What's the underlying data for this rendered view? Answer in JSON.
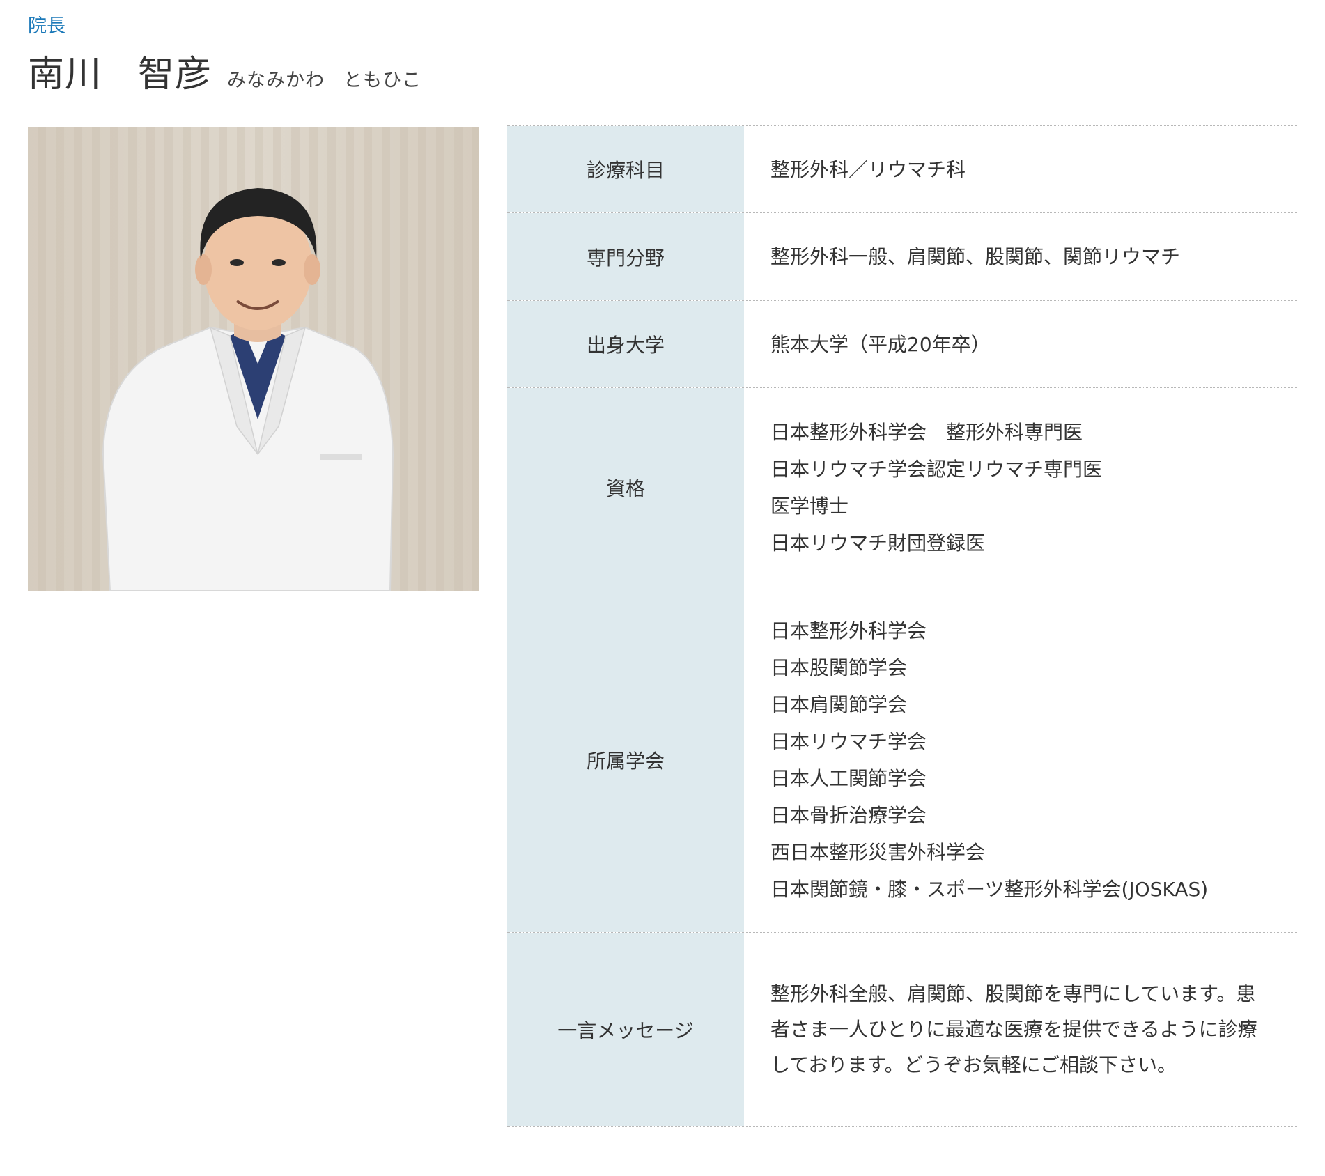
{
  "header": {
    "role": "院長",
    "name_family": "南川",
    "name_given": "智彦",
    "reading_family": "みなみかわ",
    "reading_given": "ともひこ"
  },
  "photo": {
    "alt": "院長 南川智彦の写真"
  },
  "profile": {
    "department": {
      "label": "診療科目",
      "value": "整形外科／リウマチ科"
    },
    "specialty": {
      "label": "専門分野",
      "value": "整形外科一般、肩関節、股関節、関節リウマチ"
    },
    "university": {
      "label": "出身大学",
      "value": "熊本大学（平成20年卒）"
    },
    "qualifications": {
      "label": "資格",
      "items": [
        "日本整形外科学会　整形外科専門医",
        "日本リウマチ学会認定リウマチ専門医",
        "医学博士",
        "日本リウマチ財団登録医"
      ]
    },
    "societies": {
      "label": "所属学会",
      "items": [
        "日本整形外科学会",
        "日本股関節学会",
        "日本肩関節学会",
        "日本リウマチ学会",
        "日本人工関節学会",
        "日本骨折治療学会",
        "西日本整形災害外科学会",
        "日本関節鏡・膝・スポーツ整形外科学会(JOSKAS)"
      ]
    },
    "message": {
      "label": "一言メッセージ",
      "value": "整形外科全般、肩関節、股関節を専門にしています。患者さま一人ひとりに最適な医療を提供できるように診療しております。どうぞお気軽にご相談下さい。"
    }
  }
}
